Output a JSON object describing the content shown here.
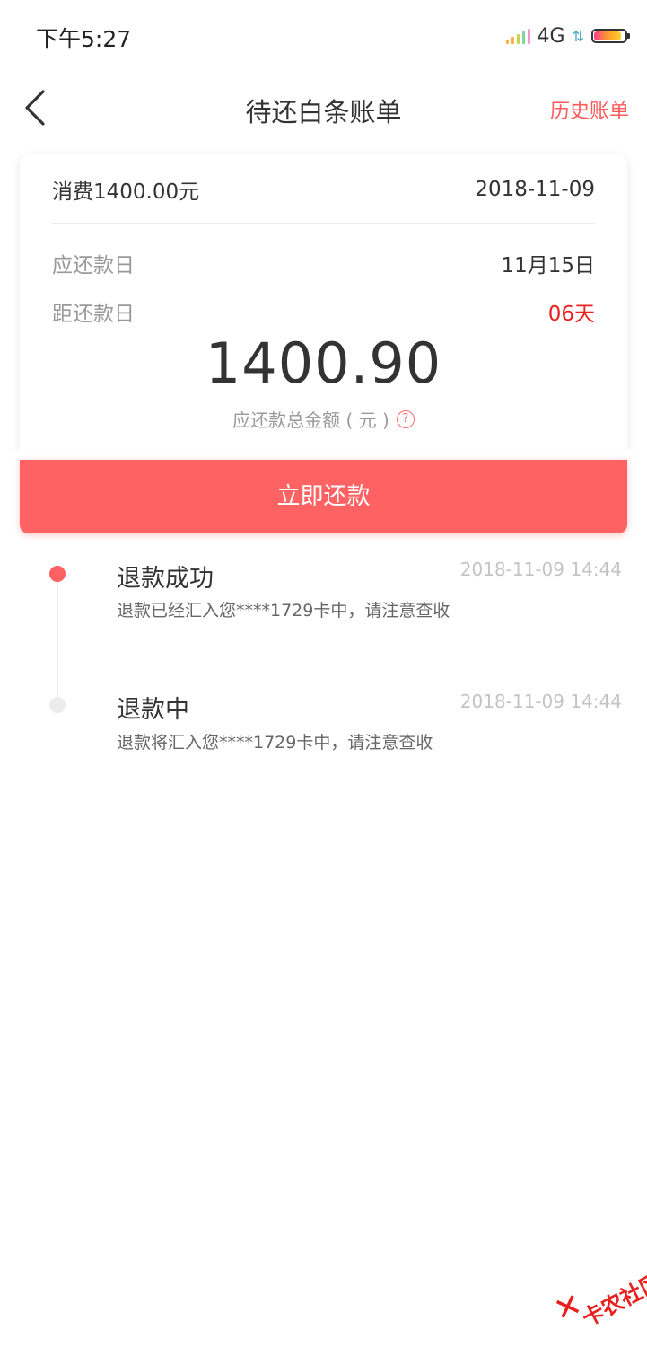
{
  "status_bar": {
    "time": "下午5:27",
    "network": "4G",
    "icons": [
      "signal-icon",
      "data-activity-icon",
      "battery-icon"
    ]
  },
  "nav": {
    "title": "待还白条账单",
    "history_label": "历史账单",
    "back_icon": "chevron-left-icon"
  },
  "bill": {
    "consume_label": "消费1400.00元",
    "consume_date": "2018-11-09",
    "due_day_label": "应还款日",
    "due_day_value": "11月15日",
    "days_left_label": "距还款日",
    "days_left_value": "06天",
    "amount": "1400.90",
    "amount_caption": "应还款总金额 ( 元 )",
    "help_icon": "?"
  },
  "repay_button": {
    "label": "立即还款"
  },
  "timeline": [
    {
      "title": "退款成功",
      "time": "2018-11-09 14:44",
      "desc": "退款已经汇入您****1729卡中，请注意查收"
    },
    {
      "title": "退款中",
      "time": "2018-11-09 14:44",
      "desc": "退款将汇入您****1729卡中，请注意查收"
    }
  ],
  "watermark": {
    "text": "卡农社区"
  },
  "colors": {
    "accent": "#ff6262",
    "alert_red": "#e8201e",
    "muted": "#999999"
  }
}
